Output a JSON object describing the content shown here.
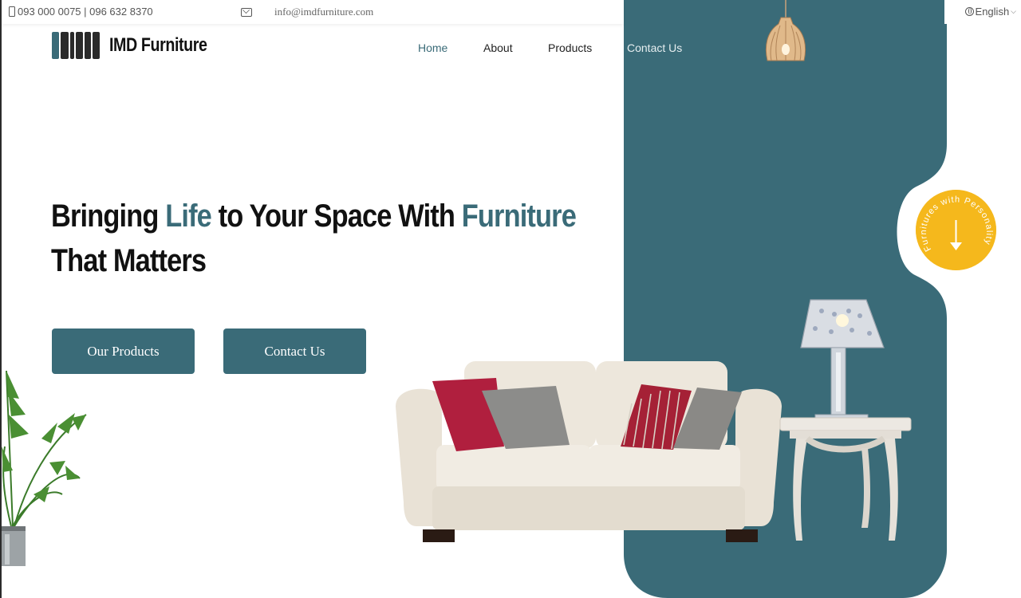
{
  "topbar": {
    "phone": "093 000 0075 | 096 632 8370",
    "email": "info@imdfurniture.com",
    "language": "English",
    "icons": [
      "phone-icon",
      "mail-icon",
      "globe-icon",
      "chevron-down-icon"
    ]
  },
  "brand": {
    "name": "IMD Furniture"
  },
  "nav": {
    "items": [
      {
        "label": "Home",
        "active": true
      },
      {
        "label": "About",
        "active": false
      },
      {
        "label": "Products",
        "active": false
      },
      {
        "label": "Contact Us",
        "active": false
      }
    ]
  },
  "hero": {
    "title_part1": "Bringing ",
    "title_accent1": "Life",
    "title_part2": " to Your Space With ",
    "title_accent2": "Furniture",
    "title_line2": "That Matters",
    "primary_button": "Our Products",
    "secondary_button": "Contact Us"
  },
  "badge": {
    "text": "Furnitures with Personality",
    "icon": "arrow-down-icon"
  },
  "colors": {
    "accent": "#3a6b78",
    "badge": "#f5b81c",
    "text": "#111111"
  }
}
